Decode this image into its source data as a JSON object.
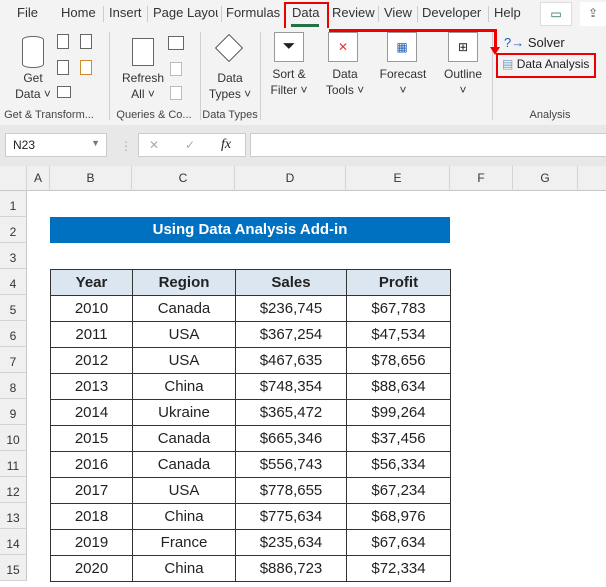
{
  "tabs": [
    "File",
    "Home",
    "Insert",
    "Page Layout",
    "Formulas",
    "Data",
    "Review",
    "View",
    "Developer",
    "Help"
  ],
  "active_tab": "Data",
  "ribbon": {
    "get_data": "Get Data ˅",
    "get_data_l1": "Get",
    "get_data_l2": "Data ˅",
    "refresh_l1": "Refresh",
    "refresh_l2": "All ˅",
    "types_l1": "Data",
    "types_l2": "Types ˅",
    "sort_l1": "Sort &",
    "sort_l2": "Filter ˅",
    "tools_l1": "Data",
    "tools_l2": "Tools ˅",
    "forecast": "Forecast",
    "outline": "Outline",
    "chev": "˅",
    "solver": "Solver",
    "data_analysis": "Data Analysis",
    "groups": [
      "Get & Transform...",
      "Queries & Co...",
      "Data Types",
      "Analysis"
    ]
  },
  "formula_bar": {
    "name_box": "N23",
    "fx": "fx",
    "cancel": "✕",
    "enter": "✓",
    "value": ""
  },
  "columns": [
    "A",
    "B",
    "C",
    "D",
    "E",
    "F",
    "G"
  ],
  "rows": [
    "1",
    "2",
    "3",
    "4",
    "5",
    "6",
    "7",
    "8",
    "9",
    "10",
    "11",
    "12",
    "13",
    "14",
    "15"
  ],
  "sheet": {
    "title": "Using Data Analysis Add-in",
    "headers": [
      "Year",
      "Region",
      "Sales",
      "Profit"
    ],
    "data": [
      [
        "2010",
        "Canada",
        "$236,745",
        "$67,783"
      ],
      [
        "2011",
        "USA",
        "$367,254",
        "$47,534"
      ],
      [
        "2012",
        "USA",
        "$467,635",
        "$78,656"
      ],
      [
        "2013",
        "China",
        "$748,354",
        "$88,634"
      ],
      [
        "2014",
        "Ukraine",
        "$365,472",
        "$99,264"
      ],
      [
        "2015",
        "Canada",
        "$665,346",
        "$37,456"
      ],
      [
        "2016",
        "Canada",
        "$556,743",
        "$56,334"
      ],
      [
        "2017",
        "USA",
        "$778,655",
        "$67,234"
      ],
      [
        "2018",
        "China",
        "$775,634",
        "$68,976"
      ],
      [
        "2019",
        "France",
        "$235,634",
        "$67,634"
      ],
      [
        "2020",
        "China",
        "$886,723",
        "$72,334"
      ]
    ]
  }
}
